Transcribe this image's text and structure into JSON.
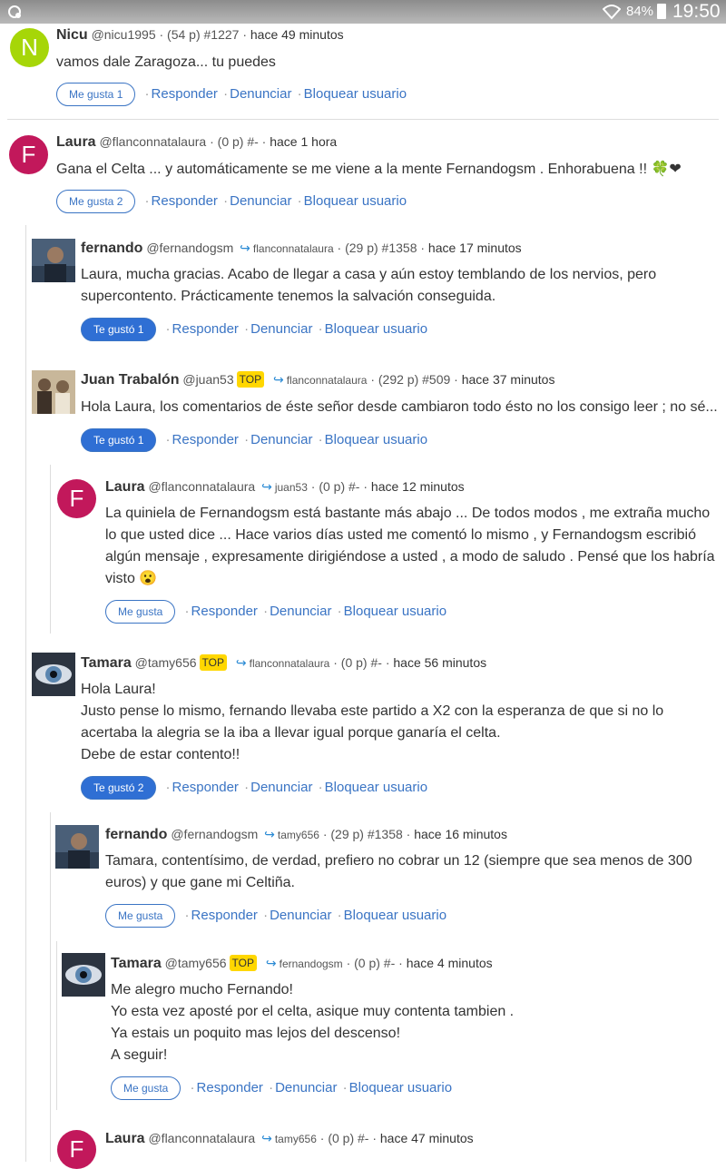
{
  "status_bar": {
    "battery": "84%",
    "time": "19:50"
  },
  "actions": {
    "reply": "Responder",
    "report": "Denunciar",
    "block": "Bloquear usuario"
  },
  "comments": [
    {
      "name": "Nicu",
      "handle": "@nicu1995",
      "meta": "· (54 p) #1227 ·",
      "time": "hace 49 minutos",
      "avatar_letter": "N",
      "avatar_color": "#a6d608",
      "text": "vamos dale Zaragoza... tu puedes",
      "like_label": "Me gusta 1"
    },
    {
      "name": "Laura",
      "handle": "@flanconnatalaura",
      "meta": "· (0 p) #- ·",
      "time": "hace 1 hora",
      "avatar_letter": "F",
      "avatar_color": "#c2185b",
      "text": "Gana el Celta ... y automáticamente se me viene a la mente Fernandogsm . Enhorabuena !! 🍀❤",
      "like_label": "Me gusta 2"
    },
    {
      "name": "fernando",
      "handle": "@fernandogsm",
      "reply_to": "flanconnatalaura",
      "meta": "· (29 p) #1358 ·",
      "time": "hace 17 minutos",
      "text_lines": [
        "Laura, mucha gracias. Acabo de llegar a casa y aún estoy temblando de los nervios, pero",
        "supercontento. Prácticamente tenemos la salvación conseguida."
      ],
      "like_label": "Te gustó 1"
    },
    {
      "name": "Juan Trabalón",
      "handle": "@juan53",
      "badge": "TOP",
      "reply_to": "flanconnatalaura",
      "meta": "· (292 p) #509 ·",
      "time": "hace 37 minutos",
      "text": "Hola Laura, los comentarios de éste señor desde cambiaron todo ésto no los consigo leer ; no sé...",
      "like_label": "Te gustó 1"
    },
    {
      "name": "Laura",
      "handle": "@flanconnatalaura",
      "reply_to": "juan53",
      "meta": "· (0 p) #- ·",
      "time": "hace 12 minutos",
      "avatar_letter": "F",
      "avatar_color": "#c2185b",
      "text_lines": [
        "La quiniela de Fernandogsm está bastante más abajo ... De todos modos , me extraña mucho",
        "lo que usted dice ... Hace varios días usted me comentó lo mismo , y Fernandogsm escribió",
        "algún mensaje , expresamente dirigiéndose a usted , a modo de saludo . Pensé que los habría",
        "visto 😮"
      ],
      "like_label": "Me gusta"
    },
    {
      "name": "Tamara",
      "handle": "@tamy656",
      "badge": "TOP",
      "reply_to": "flanconnatalaura",
      "meta": "· (0 p) #- ·",
      "time": "hace 56 minutos",
      "text_lines": [
        "Hola Laura!",
        "Justo pense lo mismo, fernando llevaba este partido a X2 con la esperanza de que si no lo",
        "acertaba la alegria se la iba a llevar igual porque ganaría el celta.",
        "Debe de estar contento!!"
      ],
      "like_label": "Te gustó 2"
    },
    {
      "name": "fernando",
      "handle": "@fernandogsm",
      "reply_to": "tamy656",
      "meta": "· (29 p) #1358 ·",
      "time": "hace 16 minutos",
      "text_lines": [
        "Tamara, contentísimo, de verdad, prefiero no cobrar un 12 (siempre que sea menos de 300",
        "euros) y que gane mi Celtiña."
      ],
      "like_label": "Me gusta"
    },
    {
      "name": "Tamara",
      "handle": "@tamy656",
      "badge": "TOP",
      "reply_to": "fernandogsm",
      "meta": "· (0 p) #- ·",
      "time": "hace 4 minutos",
      "text_lines": [
        "Me alegro mucho Fernando!",
        "Yo esta vez aposté por el celta, asique muy contenta tambien .",
        "Ya estais un poquito mas lejos del descenso!",
        "A seguir!"
      ],
      "like_label": "Me gusta"
    },
    {
      "name": "Laura",
      "handle": "@flanconnatalaura",
      "reply_to": "tamy656",
      "meta": "· (0 p) #- ·",
      "time": "hace 47 minutos",
      "avatar_letter": "F",
      "avatar_color": "#c2185b"
    }
  ]
}
